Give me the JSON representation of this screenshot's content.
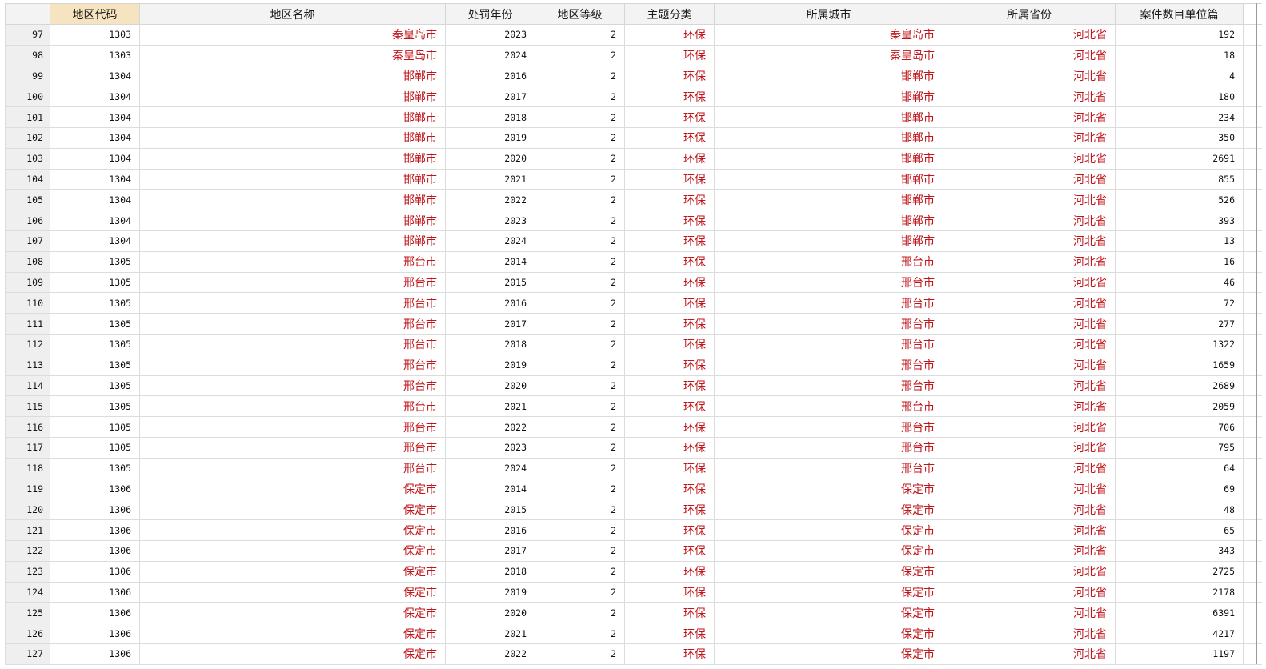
{
  "columns": [
    "地区代码",
    "地区名称",
    "处罚年份",
    "地区等级",
    "主题分类",
    "所属城市",
    "所属省份",
    "案件数目单位篇"
  ],
  "rows": [
    {
      "n": "97",
      "code": "1303",
      "name": "秦皇岛市",
      "year": "2023",
      "level": "2",
      "topic": "环保",
      "city": "秦皇岛市",
      "province": "河北省",
      "count": "192"
    },
    {
      "n": "98",
      "code": "1303",
      "name": "秦皇岛市",
      "year": "2024",
      "level": "2",
      "topic": "环保",
      "city": "秦皇岛市",
      "province": "河北省",
      "count": "18"
    },
    {
      "n": "99",
      "code": "1304",
      "name": "邯郸市",
      "year": "2016",
      "level": "2",
      "topic": "环保",
      "city": "邯郸市",
      "province": "河北省",
      "count": "4"
    },
    {
      "n": "100",
      "code": "1304",
      "name": "邯郸市",
      "year": "2017",
      "level": "2",
      "topic": "环保",
      "city": "邯郸市",
      "province": "河北省",
      "count": "180"
    },
    {
      "n": "101",
      "code": "1304",
      "name": "邯郸市",
      "year": "2018",
      "level": "2",
      "topic": "环保",
      "city": "邯郸市",
      "province": "河北省",
      "count": "234"
    },
    {
      "n": "102",
      "code": "1304",
      "name": "邯郸市",
      "year": "2019",
      "level": "2",
      "topic": "环保",
      "city": "邯郸市",
      "province": "河北省",
      "count": "350"
    },
    {
      "n": "103",
      "code": "1304",
      "name": "邯郸市",
      "year": "2020",
      "level": "2",
      "topic": "环保",
      "city": "邯郸市",
      "province": "河北省",
      "count": "2691"
    },
    {
      "n": "104",
      "code": "1304",
      "name": "邯郸市",
      "year": "2021",
      "level": "2",
      "topic": "环保",
      "city": "邯郸市",
      "province": "河北省",
      "count": "855"
    },
    {
      "n": "105",
      "code": "1304",
      "name": "邯郸市",
      "year": "2022",
      "level": "2",
      "topic": "环保",
      "city": "邯郸市",
      "province": "河北省",
      "count": "526"
    },
    {
      "n": "106",
      "code": "1304",
      "name": "邯郸市",
      "year": "2023",
      "level": "2",
      "topic": "环保",
      "city": "邯郸市",
      "province": "河北省",
      "count": "393"
    },
    {
      "n": "107",
      "code": "1304",
      "name": "邯郸市",
      "year": "2024",
      "level": "2",
      "topic": "环保",
      "city": "邯郸市",
      "province": "河北省",
      "count": "13"
    },
    {
      "n": "108",
      "code": "1305",
      "name": "邢台市",
      "year": "2014",
      "level": "2",
      "topic": "环保",
      "city": "邢台市",
      "province": "河北省",
      "count": "16"
    },
    {
      "n": "109",
      "code": "1305",
      "name": "邢台市",
      "year": "2015",
      "level": "2",
      "topic": "环保",
      "city": "邢台市",
      "province": "河北省",
      "count": "46"
    },
    {
      "n": "110",
      "code": "1305",
      "name": "邢台市",
      "year": "2016",
      "level": "2",
      "topic": "环保",
      "city": "邢台市",
      "province": "河北省",
      "count": "72"
    },
    {
      "n": "111",
      "code": "1305",
      "name": "邢台市",
      "year": "2017",
      "level": "2",
      "topic": "环保",
      "city": "邢台市",
      "province": "河北省",
      "count": "277"
    },
    {
      "n": "112",
      "code": "1305",
      "name": "邢台市",
      "year": "2018",
      "level": "2",
      "topic": "环保",
      "city": "邢台市",
      "province": "河北省",
      "count": "1322"
    },
    {
      "n": "113",
      "code": "1305",
      "name": "邢台市",
      "year": "2019",
      "level": "2",
      "topic": "环保",
      "city": "邢台市",
      "province": "河北省",
      "count": "1659"
    },
    {
      "n": "114",
      "code": "1305",
      "name": "邢台市",
      "year": "2020",
      "level": "2",
      "topic": "环保",
      "city": "邢台市",
      "province": "河北省",
      "count": "2689"
    },
    {
      "n": "115",
      "code": "1305",
      "name": "邢台市",
      "year": "2021",
      "level": "2",
      "topic": "环保",
      "city": "邢台市",
      "province": "河北省",
      "count": "2059"
    },
    {
      "n": "116",
      "code": "1305",
      "name": "邢台市",
      "year": "2022",
      "level": "2",
      "topic": "环保",
      "city": "邢台市",
      "province": "河北省",
      "count": "706"
    },
    {
      "n": "117",
      "code": "1305",
      "name": "邢台市",
      "year": "2023",
      "level": "2",
      "topic": "环保",
      "city": "邢台市",
      "province": "河北省",
      "count": "795"
    },
    {
      "n": "118",
      "code": "1305",
      "name": "邢台市",
      "year": "2024",
      "level": "2",
      "topic": "环保",
      "city": "邢台市",
      "province": "河北省",
      "count": "64"
    },
    {
      "n": "119",
      "code": "1306",
      "name": "保定市",
      "year": "2014",
      "level": "2",
      "topic": "环保",
      "city": "保定市",
      "province": "河北省",
      "count": "69"
    },
    {
      "n": "120",
      "code": "1306",
      "name": "保定市",
      "year": "2015",
      "level": "2",
      "topic": "环保",
      "city": "保定市",
      "province": "河北省",
      "count": "48"
    },
    {
      "n": "121",
      "code": "1306",
      "name": "保定市",
      "year": "2016",
      "level": "2",
      "topic": "环保",
      "city": "保定市",
      "province": "河北省",
      "count": "65"
    },
    {
      "n": "122",
      "code": "1306",
      "name": "保定市",
      "year": "2017",
      "level": "2",
      "topic": "环保",
      "city": "保定市",
      "province": "河北省",
      "count": "343"
    },
    {
      "n": "123",
      "code": "1306",
      "name": "保定市",
      "year": "2018",
      "level": "2",
      "topic": "环保",
      "city": "保定市",
      "province": "河北省",
      "count": "2725"
    },
    {
      "n": "124",
      "code": "1306",
      "name": "保定市",
      "year": "2019",
      "level": "2",
      "topic": "环保",
      "city": "保定市",
      "province": "河北省",
      "count": "2178"
    },
    {
      "n": "125",
      "code": "1306",
      "name": "保定市",
      "year": "2020",
      "level": "2",
      "topic": "环保",
      "city": "保定市",
      "province": "河北省",
      "count": "6391"
    },
    {
      "n": "126",
      "code": "1306",
      "name": "保定市",
      "year": "2021",
      "level": "2",
      "topic": "环保",
      "city": "保定市",
      "province": "河北省",
      "count": "4217"
    },
    {
      "n": "127",
      "code": "1306",
      "name": "保定市",
      "year": "2022",
      "level": "2",
      "topic": "环保",
      "city": "保定市",
      "province": "河北省",
      "count": "1197"
    }
  ],
  "colors": {
    "header_bg": "#f3f3f3",
    "sorted_header_bg": "#f6e3bf",
    "string_text": "#c0161b",
    "numeric_text": "#111111",
    "grid_line": "#d6d6d6"
  }
}
